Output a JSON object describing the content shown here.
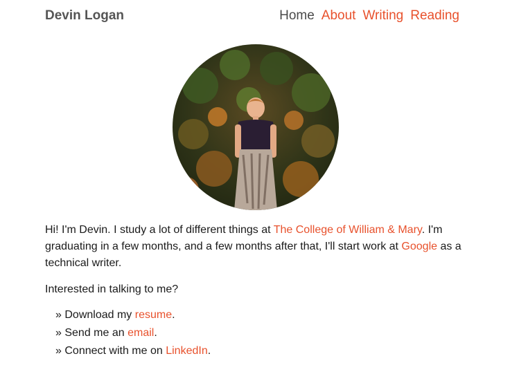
{
  "header": {
    "site_title": "Devin Logan",
    "nav": [
      {
        "label": "Home"
      },
      {
        "label": "About"
      },
      {
        "label": "Writing"
      },
      {
        "label": "Reading"
      }
    ]
  },
  "portrait": {
    "icon": "profile-photo"
  },
  "intro": {
    "part1": "Hi! I'm Devin. I study a lot of different things at ",
    "college_link": "The College of William & Mary",
    "part2": ". I'm graduating in a few months, and a few months after that, I'll start work at ",
    "google_link": "Google",
    "part3": " as a technical writer."
  },
  "contact": {
    "question": "Interested in talking to me?",
    "bullet": "»",
    "items": [
      {
        "prefix": "Download my ",
        "link": "resume",
        "suffix": "."
      },
      {
        "prefix": "Send me an ",
        "link": "email",
        "suffix": "."
      },
      {
        "prefix": "Connect with me on ",
        "link": "LinkedIn",
        "suffix": "."
      }
    ]
  },
  "colors": {
    "link": "#e8512c",
    "title": "#555555",
    "nav_current": "#4a4a4a",
    "text": "#1a1a1a"
  }
}
